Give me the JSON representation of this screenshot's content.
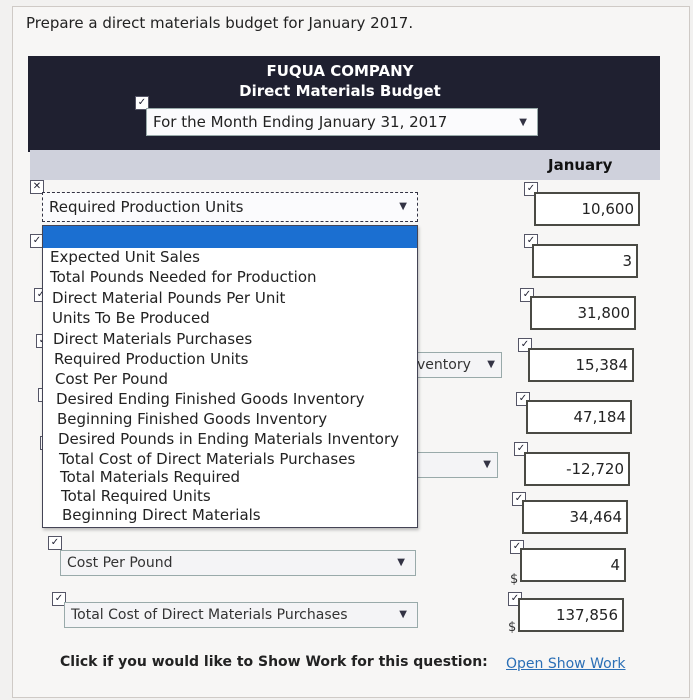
{
  "prompt": "Prepare a direct materials budget for January 2017.",
  "header": {
    "company": "FUQUA COMPANY",
    "title": "Direct Materials Budget",
    "period_value": "For the Month Ending January 31, 2017"
  },
  "columns": {
    "month": "January"
  },
  "active_row": {
    "selected_label": "Required Production Units"
  },
  "dropdown_options": [
    "Expected Unit Sales",
    "Total Pounds Needed for Production",
    "Direct Material Pounds Per Unit",
    "Units To Be Produced",
    "Direct Materials Purchases",
    "Required Production Units",
    "Cost Per Pound",
    "Desired Ending Finished Goods Inventory",
    "Beginning Finished Goods Inventory",
    "Desired Pounds in Ending Materials Inventory",
    "Total Cost of Direct Materials Purchases",
    "Total Materials Required",
    "Total Required Units",
    "Beginning Direct Materials"
  ],
  "partial_select": {
    "text": "ventory"
  },
  "values": [
    "10,600",
    "3",
    "31,800",
    "15,384",
    "47,184",
    "-12,720",
    "34,464",
    "4",
    "137,856"
  ],
  "lower_rows": {
    "cost_per_pound": "Cost Per Pound",
    "total_cost": "Total Cost of Direct Materials Purchases",
    "dollar": "$"
  },
  "footer": {
    "text": "Click if you would like to Show Work for this question:",
    "link": "Open Show Work"
  },
  "icons": {
    "check": "checkmark-icon",
    "close": "x-icon",
    "caret": "caret-down-icon"
  }
}
